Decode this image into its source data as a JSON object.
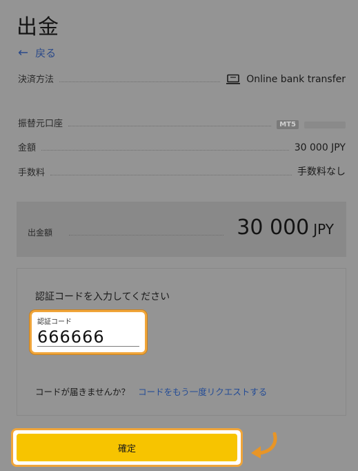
{
  "page": {
    "title": "出金",
    "back_label": "戻る"
  },
  "details": {
    "method": {
      "label": "決済方法",
      "value": "Online bank transfer",
      "icon": "laptop-icon"
    },
    "account": {
      "label": "振替元口座",
      "badge": "MT5"
    },
    "amount": {
      "label": "金額",
      "value": "30 000 JPY"
    },
    "fee": {
      "label": "手数料",
      "value": "手数料なし"
    }
  },
  "total": {
    "label": "出金額",
    "amount": "30 000",
    "currency": "JPY"
  },
  "verification": {
    "prompt": "認証コードを入力してください",
    "field_label": "認証コード",
    "field_value": "666666",
    "resend_question": "コードが届きませんか？",
    "resend_link": "コードをもう一度リクエストする"
  },
  "confirm": {
    "label": "確定"
  },
  "colors": {
    "accent": "#f7c400",
    "highlight": "#f0a53a",
    "link": "#244c96"
  }
}
